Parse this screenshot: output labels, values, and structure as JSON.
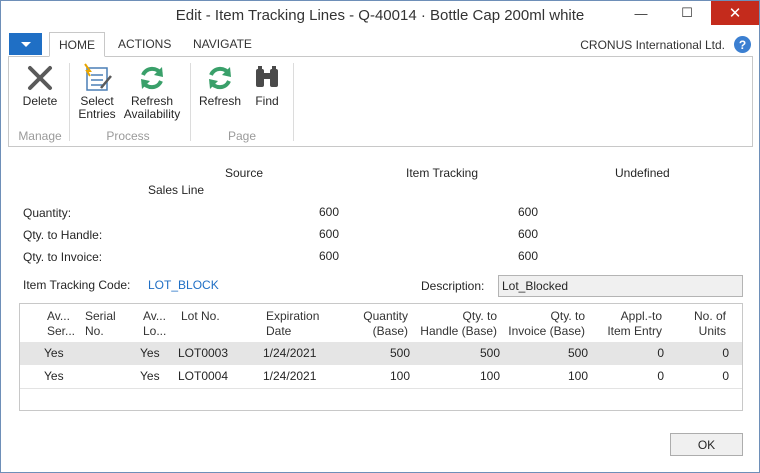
{
  "window": {
    "title": "Edit - Item Tracking Lines - Q-40014 · Bottle Cap 200ml white",
    "minimize_glyph": "—",
    "maximize_glyph": "☐",
    "close_glyph": "✕"
  },
  "ribbon_tabs": {
    "home": "HOME",
    "actions": "ACTIONS",
    "navigate": "NAVIGATE"
  },
  "company": "CRONUS International Ltd.",
  "help_glyph": "?",
  "ribbon": {
    "delete": "Delete",
    "select_entries": [
      "Select",
      "Entries"
    ],
    "refresh_availability": [
      "Refresh",
      "Availability"
    ],
    "refresh": "Refresh",
    "find": "Find",
    "groups": {
      "manage": "Manage",
      "process": "Process",
      "page": "Page"
    }
  },
  "summary": {
    "col_source": "Source",
    "col_source_sub": "Sales Line",
    "col_item_tracking": "Item Tracking",
    "col_undefined": "Undefined",
    "rows": [
      {
        "label": "Quantity:",
        "source": "600",
        "tracking": "600"
      },
      {
        "label": "Qty. to Handle:",
        "source": "600",
        "tracking": "600"
      },
      {
        "label": "Qty. to Invoice:",
        "source": "600",
        "tracking": "600"
      }
    ]
  },
  "item_tracking_code": {
    "label": "Item Tracking Code:",
    "value": "LOT_BLOCK"
  },
  "description": {
    "label": "Description:",
    "value": "Lot_Blocked"
  },
  "grid": {
    "headers": [
      [
        "Av...",
        "Ser..."
      ],
      [
        "Serial",
        "No."
      ],
      [
        "Av...",
        "Lo..."
      ],
      [
        "Lot No.",
        ""
      ],
      [
        "Expiration",
        "Date"
      ],
      [
        "Quantity",
        "(Base)"
      ],
      [
        "Qty. to",
        "Handle (Base)"
      ],
      [
        "Qty. to",
        "Invoice (Base)"
      ],
      [
        "Appl.-to",
        "Item Entry"
      ],
      [
        "No. of",
        "Units"
      ]
    ],
    "rows": [
      {
        "av_serial": "Yes",
        "serial": "",
        "av_lot": "Yes",
        "lot": "LOT0003",
        "exp": "1/24/2021",
        "qty": "500",
        "handle": "500",
        "invoice": "500",
        "appl": "0",
        "units": "0"
      },
      {
        "av_serial": "Yes",
        "serial": "",
        "av_lot": "Yes",
        "lot": "LOT0004",
        "exp": "1/24/2021",
        "qty": "100",
        "handle": "100",
        "invoice": "100",
        "appl": "0",
        "units": "0"
      }
    ]
  },
  "ok_label": "OK",
  "colors": {
    "accent": "#1f6fc5",
    "close": "#c42b1c",
    "selected_row": "#e5e5e5"
  }
}
